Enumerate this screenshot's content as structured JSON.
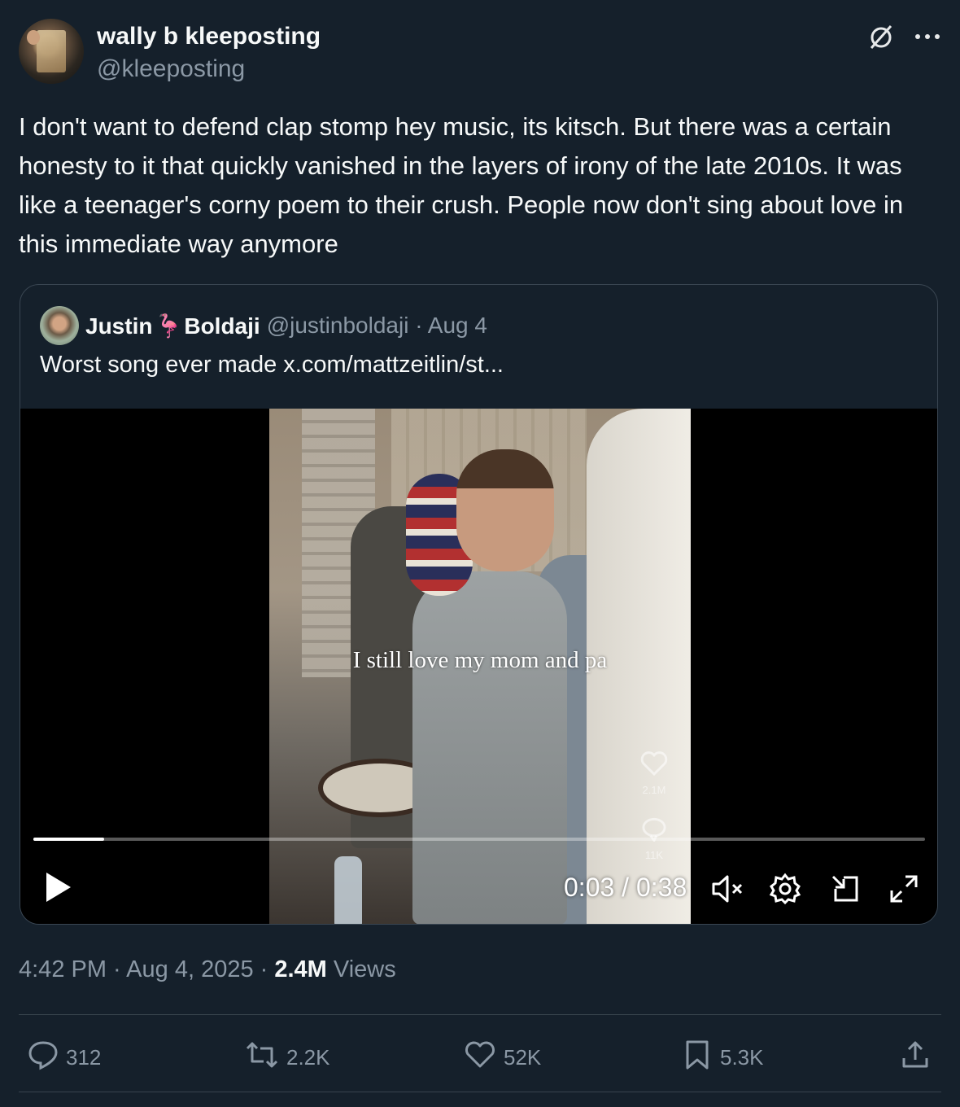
{
  "author": {
    "display_name": "wally b kleeposting",
    "handle": "@kleeposting"
  },
  "tweet": {
    "text": "I don't want to defend clap stomp hey music, its kitsch. But there was a certain honesty to it that quickly vanished in the layers of irony of the late 2010s. It was like a teenager's corny poem to their crush. People now don't sing about love in this immediate way anymore"
  },
  "quoted": {
    "name_first": "Justin",
    "flamingo_emoji": "🦩",
    "name_last": "Boldaji",
    "handle_date": "@justinboldaji · Aug 4",
    "text": "Worst song ever made  x.com/mattzeitlin/st..."
  },
  "video": {
    "caption": "I still love my mom and pa",
    "likes": "2.1M",
    "comments": "11K",
    "time": "0:03 / 0:38",
    "progress_fraction": 0.079
  },
  "meta": {
    "timestamp": "4:42 PM · Aug 4, 2025 · ",
    "views_count": "2.4M",
    "views_label": " Views"
  },
  "actions": {
    "replies": "312",
    "reposts": "2.2K",
    "likes": "52K",
    "bookmarks": "5.3K"
  },
  "icons": [
    "grok-icon",
    "more-icon",
    "play-icon",
    "mute-icon",
    "settings-icon",
    "picture-in-picture-icon",
    "fullscreen-icon",
    "reply-icon",
    "repost-icon",
    "like-icon",
    "bookmark-icon",
    "share-icon"
  ],
  "colors": {
    "background": "#15202b",
    "text": "#f7f9f9",
    "secondary": "#8b98a5",
    "border": "#38444d"
  }
}
